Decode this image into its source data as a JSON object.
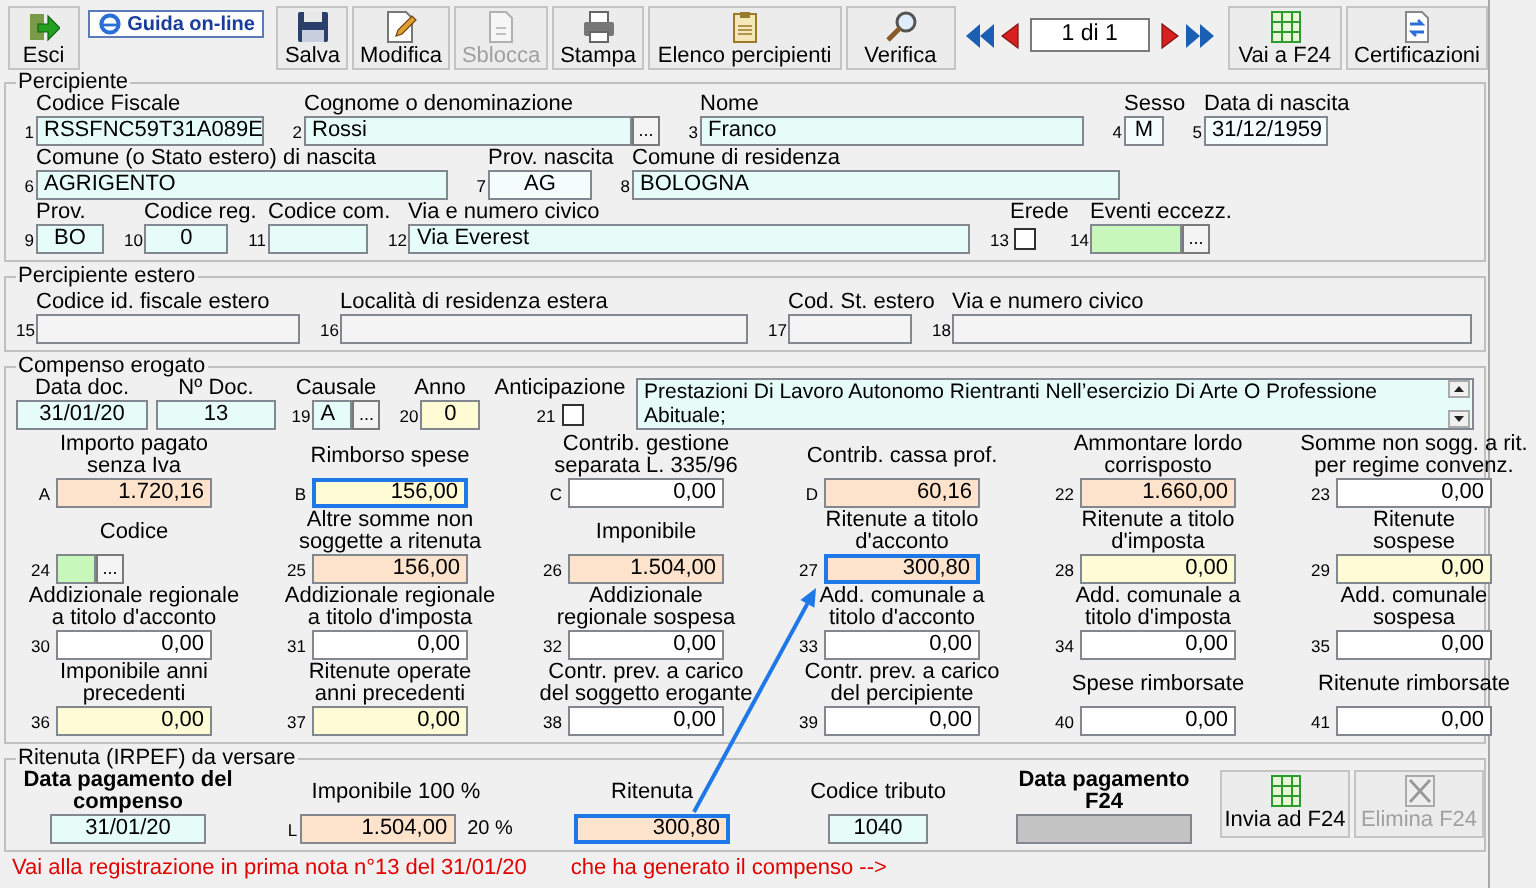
{
  "toolbar": {
    "items": [
      {
        "kind": "button",
        "label": "Esci",
        "disabled": false
      },
      {
        "kind": "link",
        "label": "Guida on-line"
      },
      {
        "kind": "button",
        "label": "Salva",
        "disabled": false
      },
      {
        "kind": "button",
        "label": "Modifica",
        "disabled": false
      },
      {
        "kind": "button",
        "label": "Sblocca",
        "disabled": true
      },
      {
        "kind": "button",
        "label": "Stampa",
        "disabled": false
      },
      {
        "kind": "button",
        "label": "Elenco percipienti",
        "disabled": false
      },
      {
        "kind": "button",
        "label": "Verifica",
        "disabled": false
      },
      {
        "kind": "pager",
        "value": "1 di 1"
      },
      {
        "kind": "button",
        "label": "Vai a F24",
        "disabled": false
      },
      {
        "kind": "button",
        "label": "Certificazioni",
        "disabled": false
      }
    ]
  },
  "percipiente": {
    "title": "Percipiente",
    "lines": [
      {
        "fields": [
          {
            "n": "1",
            "label": "Codice Fiscale",
            "kind": "text",
            "value": "RSSFNC59T31A089E",
            "color": "#e6fcf9"
          },
          {
            "n": "2",
            "label": "Cognome o denominazione",
            "kind": "lookup",
            "value": "Rossi",
            "button": "...",
            "color": "#e6fcf9"
          },
          {
            "n": "3",
            "label": "Nome",
            "kind": "text",
            "value": "Franco",
            "color": "#e6fcf9"
          },
          {
            "n": "4",
            "label": "Sesso",
            "kind": "code",
            "value": "M",
            "color": "#f6fefd"
          },
          {
            "n": "5",
            "label": "Data di nascita",
            "kind": "text",
            "value": "31/12/1959",
            "color": "#f6fefd"
          }
        ]
      },
      {
        "fields": [
          {
            "n": "6",
            "label": "Comune (o Stato estero) di nascita",
            "kind": "text",
            "value": "AGRIGENTO",
            "color": "#e6fcf9"
          },
          {
            "n": "7",
            "label": "Prov. nascita",
            "kind": "code",
            "value": "AG",
            "color": "#f6fefd"
          },
          {
            "n": "8",
            "label": "Comune di residenza",
            "kind": "text",
            "value": "BOLOGNA",
            "color": "#e6fcf9"
          }
        ]
      },
      {
        "fields": [
          {
            "n": "9",
            "label": "Prov.",
            "kind": "code",
            "value": "BO",
            "color": "#e6fcf9"
          },
          {
            "n": "10",
            "label": "Codice reg.",
            "kind": "code",
            "value": "0",
            "color": "#e6fcf9"
          },
          {
            "n": "11",
            "label": "Codice com.",
            "kind": "code",
            "color": "#e6fcf9"
          },
          {
            "n": "12",
            "label": "Via e numero civico",
            "kind": "text",
            "value": "Via Everest",
            "color": "#e6fcf9"
          },
          {
            "n": "13",
            "label": "Erede",
            "kind": "checkbox",
            "checked": false
          },
          {
            "n": "14",
            "label": "Eventi eccezz.",
            "kind": "lookup",
            "button": "...",
            "color": "#c8f7bc"
          }
        ]
      }
    ]
  },
  "percipiente_estero": {
    "title": "Percipiente estero",
    "lines": [
      {
        "fields": [
          {
            "n": "15",
            "label": "Codice id. fiscale estero",
            "kind": "text",
            "color": "#f4f4f4"
          },
          {
            "n": "16",
            "label": "Località di residenza estera",
            "kind": "text",
            "color": "#f4f4f4"
          },
          {
            "n": "17",
            "label": "Cod. St. estero",
            "kind": "text",
            "color": "#f4f4f4"
          },
          {
            "n": "18",
            "label": "Via e numero civico",
            "kind": "text",
            "color": "#f4f4f4"
          }
        ]
      }
    ]
  },
  "compenso": {
    "title": "Compenso erogato",
    "header": [
      {
        "label": "Data doc.",
        "kind": "code",
        "value": "31/01/20",
        "color": "#e6fcf9"
      },
      {
        "label": "Nº Doc.",
        "kind": "code",
        "value": "13",
        "color": "#e6fcf9"
      },
      {
        "n": "19",
        "label": "Causale",
        "kind": "lookup",
        "value": "A",
        "button": "...",
        "color": "#e6fcf9"
      },
      {
        "n": "20",
        "label": "Anno",
        "kind": "code",
        "value": "0",
        "color": "#fffbd4"
      },
      {
        "n": "21",
        "label": "Anticipazione",
        "kind": "checkbox",
        "checked": false
      },
      {
        "kind": "memo",
        "value": "Prestazioni Di Lavoro Autonomo Rientranti Nell’esercizio Di Arte O Professione Abituale;",
        "color": "#e6fcf9"
      }
    ],
    "amounts": [
      [
        {
          "n": "A",
          "label": "Importo pagato\nsenza Iva",
          "kind": "amount",
          "value": "1.720,16",
          "color": "#fde3cb",
          "highlighted": false
        },
        {
          "n": "B",
          "label": "Rimborso spese",
          "kind": "amount",
          "value": "156,00",
          "color": "#fffbd4",
          "highlighted": true
        },
        {
          "n": "C",
          "label": "Contrib. gestione\nseparata L. 335/96",
          "kind": "amount",
          "value": "0,00",
          "color": "#ffffff",
          "highlighted": false
        },
        {
          "n": "D",
          "label": "Contrib. cassa prof.",
          "kind": "amount",
          "value": "60,16",
          "color": "#fde3cb",
          "highlighted": false
        },
        {
          "n": "22",
          "label": "Ammontare lordo\ncorrisposto",
          "kind": "amount",
          "value": "1.660,00",
          "color": "#fde3cb",
          "highlighted": false
        },
        {
          "n": "23",
          "label": "Somme non sogg. a rit.\nper regime convenz.",
          "kind": "amount",
          "value": "0,00",
          "color": "#ffffff",
          "highlighted": false
        }
      ],
      [
        {
          "n": "24",
          "label": "Codice",
          "kind": "lookup",
          "button": "...",
          "color": "#c8f7bc",
          "highlighted": false
        },
        {
          "n": "25",
          "label": "Altre somme non\nsoggette a ritenuta",
          "kind": "amount",
          "value": "156,00",
          "color": "#fde3cb",
          "highlighted": false
        },
        {
          "n": "26",
          "label": "Imponibile",
          "kind": "amount",
          "value": "1.504,00",
          "color": "#fde3cb",
          "highlighted": false
        },
        {
          "n": "27",
          "label": "Ritenute a titolo\nd'acconto",
          "kind": "amount",
          "value": "300,80",
          "color": "#fde3cb",
          "highlighted": true
        },
        {
          "n": "28",
          "label": "Ritenute a titolo\nd'imposta",
          "kind": "amount",
          "value": "0,00",
          "color": "#fffbd4",
          "highlighted": false
        },
        {
          "n": "29",
          "label": "Ritenute\nsospese",
          "kind": "amount",
          "value": "0,00",
          "color": "#fffbd4",
          "highlighted": false
        }
      ],
      [
        {
          "n": "30",
          "label": "Addizionale regionale\na titolo d'acconto",
          "kind": "amount",
          "value": "0,00",
          "color": "#ffffff",
          "highlighted": false
        },
        {
          "n": "31",
          "label": "Addizionale regionale\na titolo d'imposta",
          "kind": "amount",
          "value": "0,00",
          "color": "#ffffff",
          "highlighted": false
        },
        {
          "n": "32",
          "label": "Addizionale\nregionale sospesa",
          "kind": "amount",
          "value": "0,00",
          "color": "#ffffff",
          "highlighted": false
        },
        {
          "n": "33",
          "label": "Add. comunale a\ntitolo d'acconto",
          "kind": "amount",
          "value": "0,00",
          "color": "#ffffff",
          "highlighted": false
        },
        {
          "n": "34",
          "label": "Add. comunale a\ntitolo d'imposta",
          "kind": "amount",
          "value": "0,00",
          "color": "#ffffff",
          "highlighted": false
        },
        {
          "n": "35",
          "label": "Add. comunale\nsospesa",
          "kind": "amount",
          "value": "0,00",
          "color": "#ffffff",
          "highlighted": false
        }
      ],
      [
        {
          "n": "36",
          "label": "Imponibile anni\nprecedenti",
          "kind": "amount",
          "value": "0,00",
          "color": "#fffbd4",
          "highlighted": false
        },
        {
          "n": "37",
          "label": "Ritenute operate\nanni precedenti",
          "kind": "amount",
          "value": "0,00",
          "color": "#fffbd4",
          "highlighted": false
        },
        {
          "n": "38",
          "label": "Contr. prev. a carico\ndel soggetto erogante",
          "kind": "amount",
          "value": "0,00",
          "color": "#ffffff",
          "highlighted": false
        },
        {
          "n": "39",
          "label": "Contr. prev. a carico\ndel percipiente",
          "kind": "amount",
          "value": "0,00",
          "color": "#ffffff",
          "highlighted": false
        },
        {
          "n": "40",
          "label": "Spese rimborsate",
          "kind": "amount",
          "value": "0,00",
          "color": "#ffffff",
          "highlighted": false
        },
        {
          "n": "41",
          "label": "Ritenute rimborsate",
          "kind": "amount",
          "value": "0,00",
          "color": "#ffffff",
          "highlighted": false
        }
      ]
    ]
  },
  "ritenuta": {
    "title": "Ritenuta (IRPEF) da versare",
    "fields": [
      {
        "label": "Data pagamento del\ncompenso",
        "bold": true,
        "kind": "code",
        "value": "31/01/20",
        "color": "#e6fcf9",
        "highlighted": false
      },
      {
        "n": "L",
        "label": "Imponibile 100 %",
        "bold": false,
        "kind": "amount",
        "value": "1.504,00",
        "suffix": "20 %",
        "color": "#fde3cb",
        "highlighted": false
      },
      {
        "label": "Ritenuta",
        "bold": false,
        "kind": "amount",
        "value": "300,80",
        "color": "#fde3cb",
        "highlighted": true
      },
      {
        "label": "Codice tributo",
        "bold": false,
        "kind": "code",
        "value": "1040",
        "color": "#e6fcf9",
        "highlighted": false
      },
      {
        "label": "Data pagamento\nF24",
        "bold": true,
        "kind": "code",
        "color": "#c4c4c4",
        "highlighted": false
      }
    ],
    "buttons": [
      {
        "label": "Invia ad F24",
        "disabled": false
      },
      {
        "label": "Elimina F24",
        "disabled": true
      }
    ]
  },
  "footer": {
    "link": "Vai alla registrazione in prima nota n°13 del 31/01/20",
    "note": "che ha generato il compenso -->"
  }
}
